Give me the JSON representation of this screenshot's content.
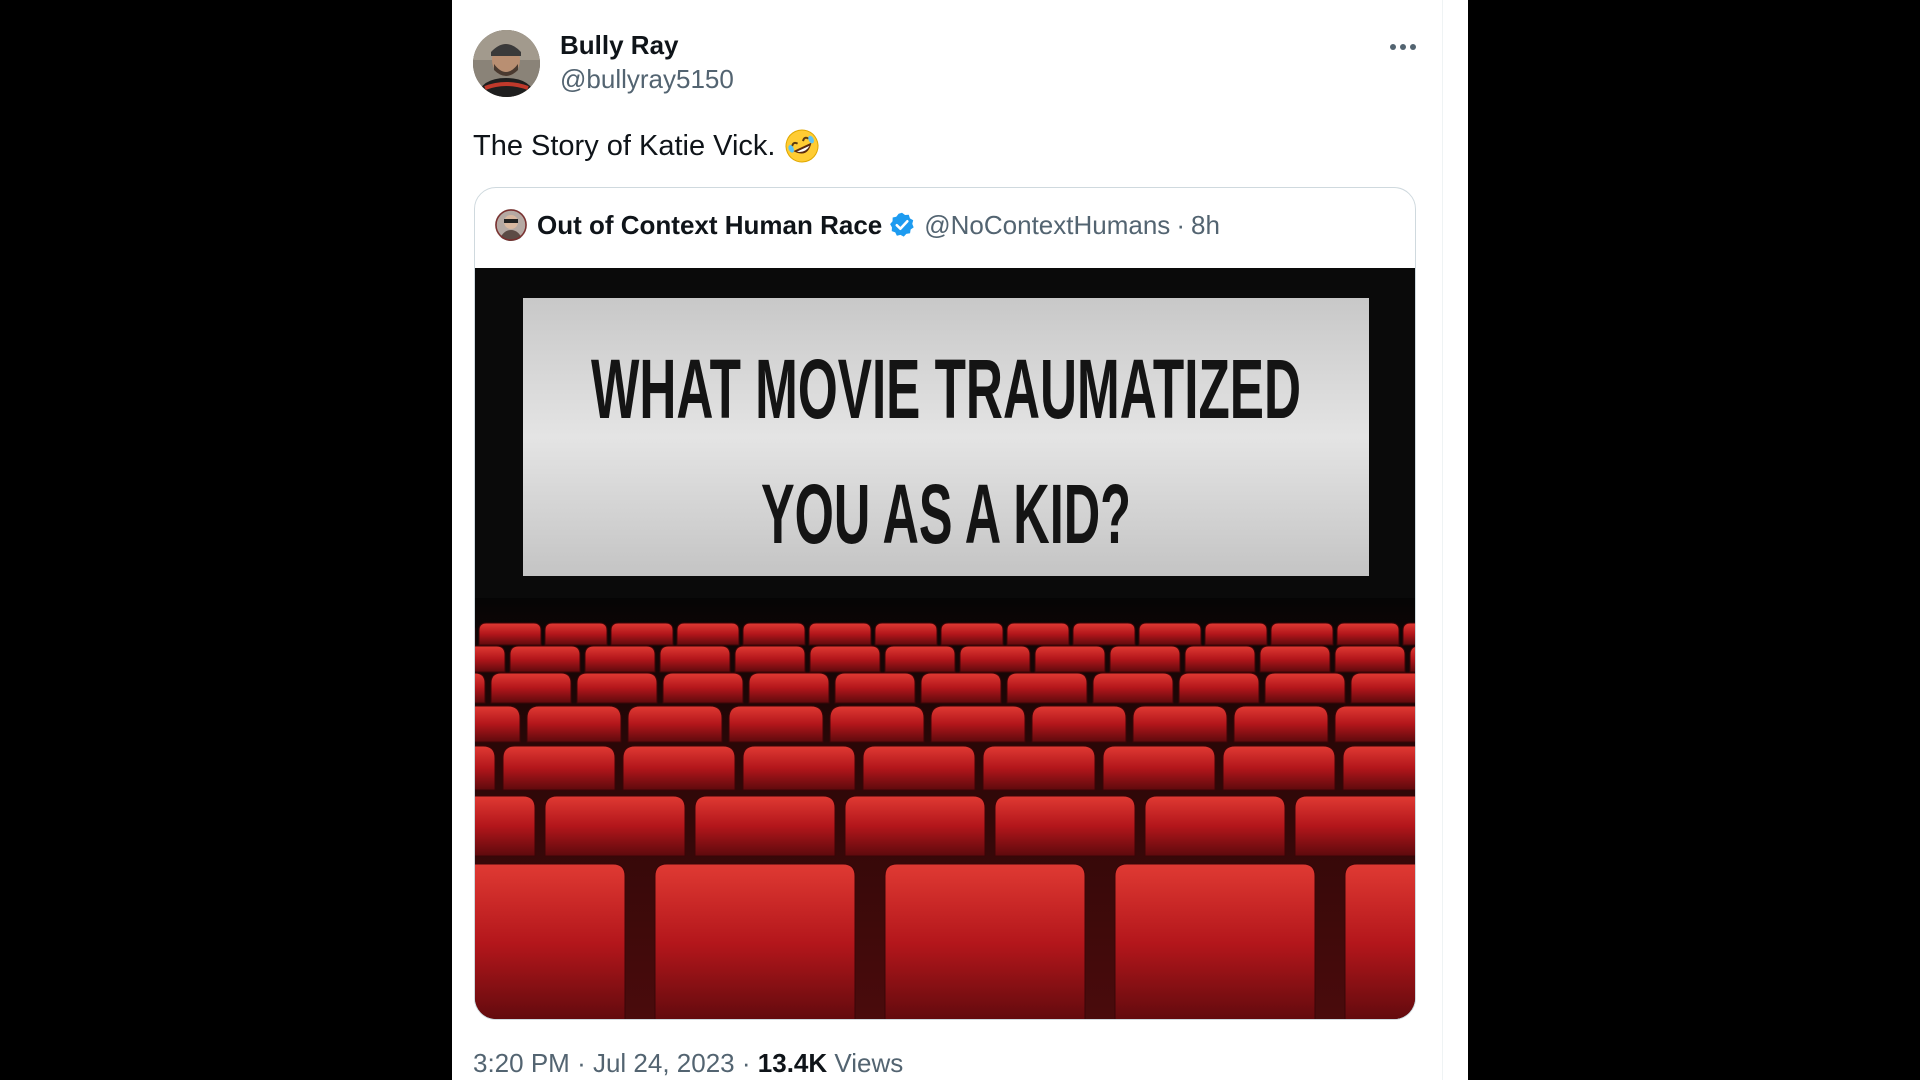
{
  "tweet": {
    "author_name": "Bully Ray",
    "author_handle": "@bullyray5150",
    "text": "The Story of Katie Vick.",
    "emoji": "🤣",
    "time": "3:20 PM",
    "date": "Jul 24, 2023",
    "views_count": "13.4K",
    "views_label": "Views",
    "separator": "·"
  },
  "quote": {
    "author_name": "Out of Context Human Race",
    "author_handle": "@NoContextHumans",
    "separator": "·",
    "time": "8h",
    "media": {
      "line1": "WHAT MOVIE TRAUMATIZED",
      "line2": "YOU AS A KID?"
    }
  },
  "icons": {
    "more": "more-horizontal-icon",
    "verified": "verified-badge-icon",
    "emoji": "rolling-on-floor-laughing-emoji"
  },
  "colors": {
    "text_primary": "#0f1419",
    "text_secondary": "#536471",
    "verified_blue": "#1d9bf0",
    "seat_red": "#b3161b",
    "screen_gray": "#cfcfcf"
  }
}
